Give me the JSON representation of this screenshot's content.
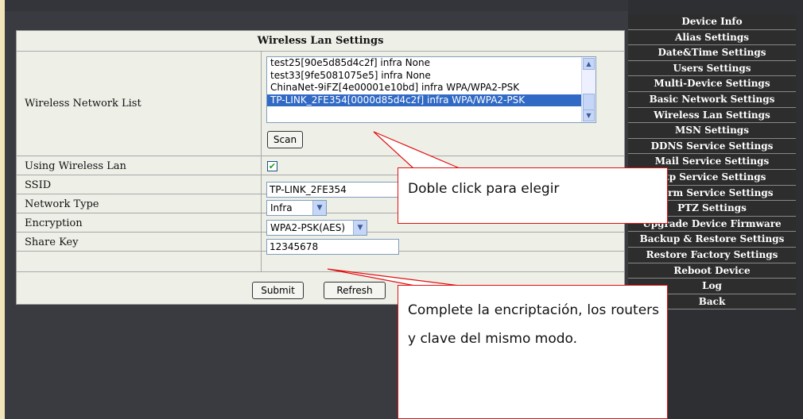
{
  "panel": {
    "title": "Wireless Lan Settings",
    "labels": {
      "network_list": "Wireless Network List",
      "using_wireless": "Using Wireless Lan",
      "ssid": "SSID",
      "network_type": "Network Type",
      "encryption": "Encryption",
      "share_key": "Share Key"
    },
    "networks": [
      "test25[90e5d85d4c2f] infra None",
      "test33[9fe5081075e5] infra None",
      "ChinaNet-9iFZ[4e00001e10bd] infra WPA/WPA2-PSK",
      "TP-LINK_2FE354[0000d85d4c2f] infra WPA/WPA2-PSK"
    ],
    "selected_network_index": 3,
    "scan_label": "Scan",
    "using_wireless_checked": true,
    "ssid_value": "TP-LINK_2FE354",
    "network_type_value": "Infra",
    "encryption_value": "WPA2-PSK(AES)",
    "share_key_value": "12345678",
    "submit_label": "Submit",
    "refresh_label": "Refresh"
  },
  "menu": [
    "Device Info",
    "Alias Settings",
    "Date&Time Settings",
    "Users Settings",
    "Multi-Device Settings",
    "Basic Network Settings",
    "Wireless Lan Settings",
    "MSN Settings",
    "DDNS Service Settings",
    "Mail Service Settings",
    "Ftp Service Settings",
    "Alarm Service Settings",
    "PTZ Settings",
    "Upgrade Device Firmware",
    "Backup & Restore Settings",
    "Restore Factory Settings",
    "Reboot Device",
    "Log",
    "Back"
  ],
  "callouts": {
    "first": "Doble click para elegir",
    "second": "Complete la encriptación, los routers y clave del mismo modo."
  },
  "colors": {
    "accent": "#316ac5",
    "callout_border": "#e01010",
    "menu_bg": "#2d2d2d"
  }
}
